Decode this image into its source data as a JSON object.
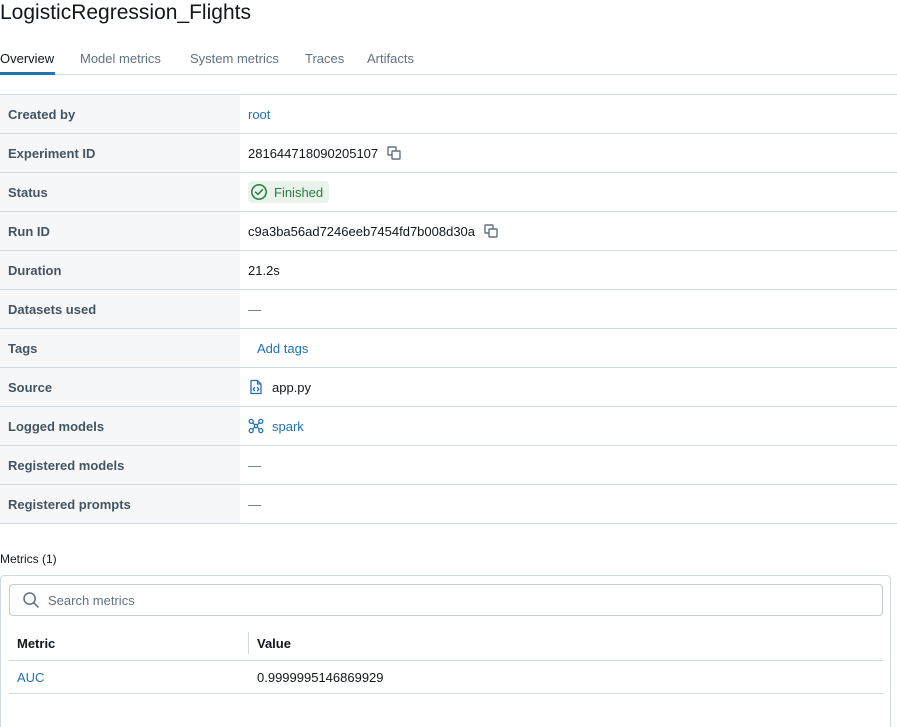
{
  "run": {
    "title": "LogisticRegression_Flights"
  },
  "tabs": [
    {
      "label": "Overview",
      "active": true
    },
    {
      "label": "Model metrics",
      "active": false
    },
    {
      "label": "System metrics",
      "active": false
    },
    {
      "label": "Traces",
      "active": false
    },
    {
      "label": "Artifacts",
      "active": false
    }
  ],
  "details": {
    "created_by": {
      "label": "Created by",
      "value": "root"
    },
    "experiment_id": {
      "label": "Experiment ID",
      "value": "281644718090205107",
      "icon": "copy-icon"
    },
    "status": {
      "label": "Status",
      "value": "Finished",
      "icon": "check-circle-icon",
      "color": "#277c43"
    },
    "run_id": {
      "label": "Run ID",
      "value": "c9a3ba56ad7246eeb7454fd7b008d30a",
      "icon": "copy-icon"
    },
    "duration": {
      "label": "Duration",
      "value": "21.2s"
    },
    "datasets_used": {
      "label": "Datasets used",
      "value": "—"
    },
    "tags": {
      "label": "Tags",
      "value": "Add tags"
    },
    "source": {
      "label": "Source",
      "value": "app.py",
      "icon": "file-code-icon"
    },
    "logged_models": {
      "label": "Logged models",
      "value": "spark",
      "icon": "model-graph-icon"
    },
    "registered_models": {
      "label": "Registered models",
      "value": "—"
    },
    "registered_prompts": {
      "label": "Registered prompts",
      "value": "—"
    }
  },
  "metrics": {
    "heading": "Metrics (1)",
    "search_placeholder": "Search metrics",
    "columns": [
      "Metric",
      "Value"
    ],
    "rows": [
      {
        "metric": "AUC",
        "value": "0.9999995146869929"
      }
    ]
  },
  "colors": {
    "accent": "#2272b4",
    "success": "#277c43"
  }
}
